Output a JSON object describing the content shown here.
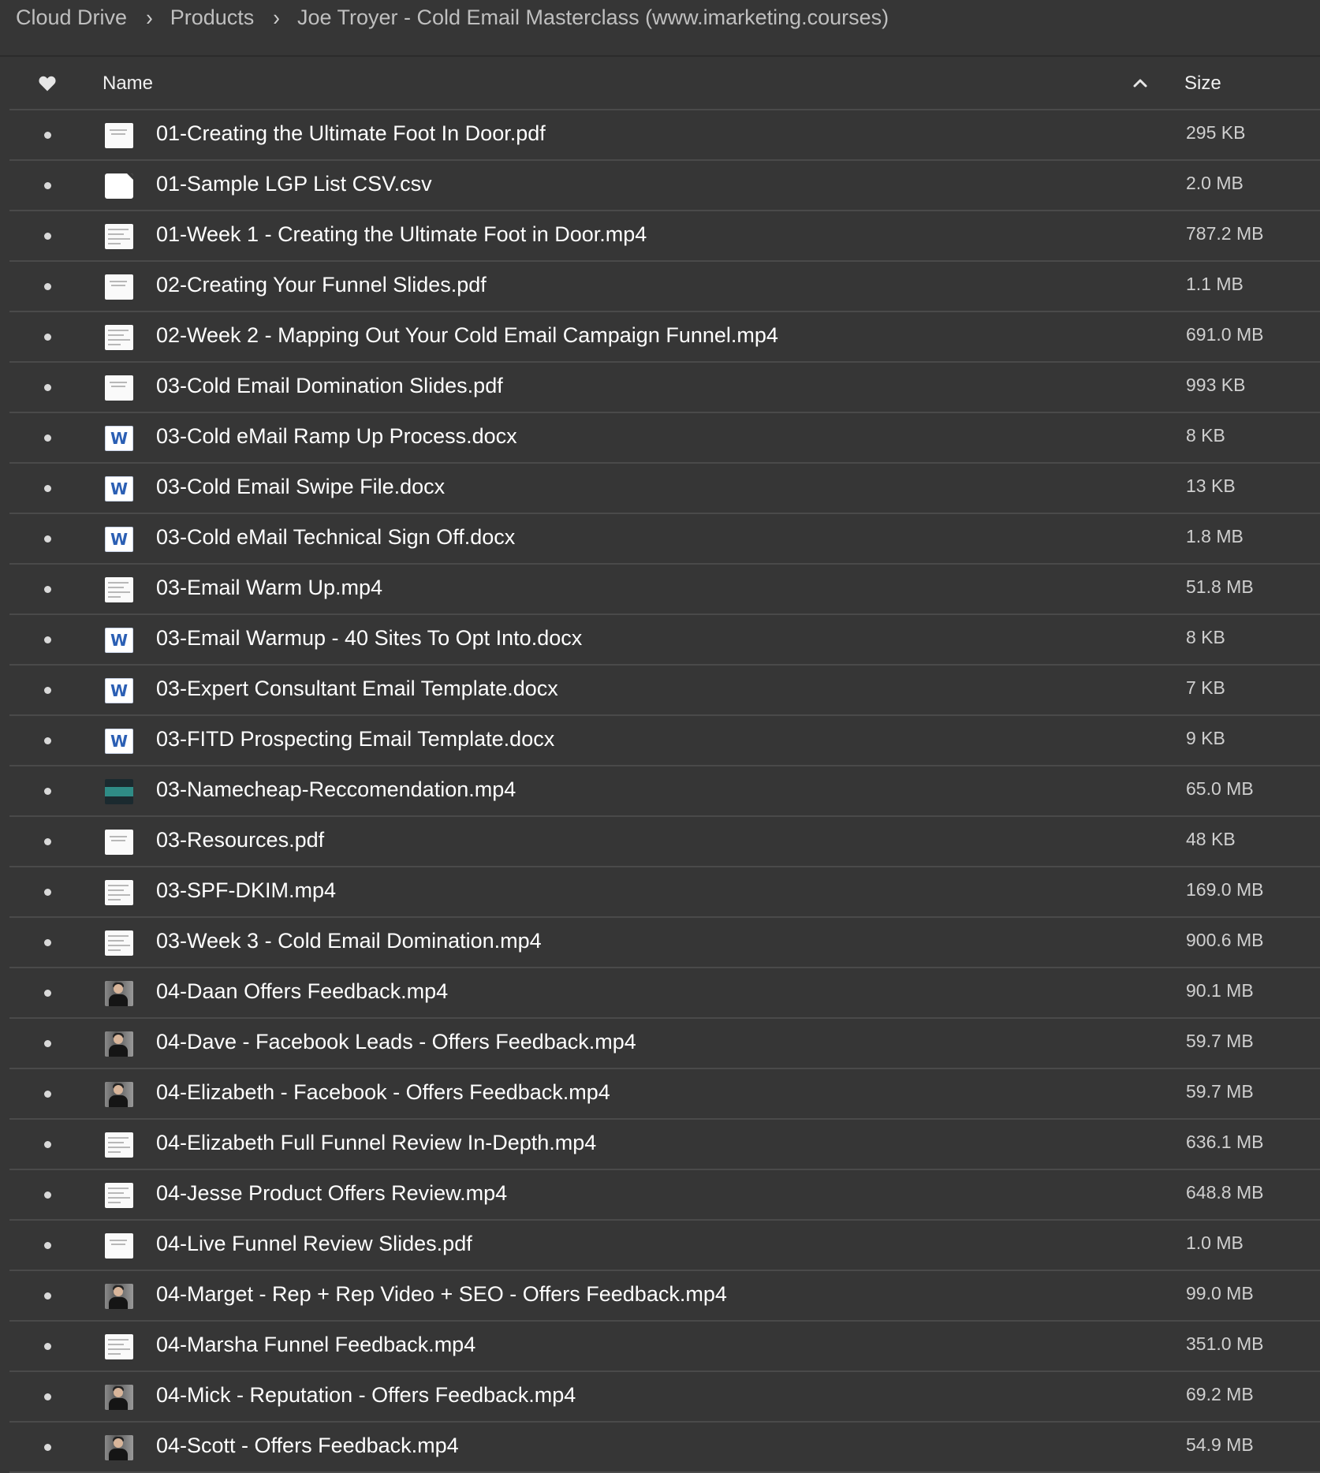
{
  "breadcrumb": [
    "Cloud Drive",
    "Products",
    "Joe Troyer - Cold Email Masterclass (www.imarketing.courses)"
  ],
  "header": {
    "name_label": "Name",
    "size_label": "Size",
    "sort_direction": "ascending"
  },
  "files": [
    {
      "name": "01-Creating the Ultimate Foot In Door.pdf",
      "size": "295 KB",
      "thumb": "slide"
    },
    {
      "name": "01-Sample LGP List CSV.csv",
      "size": "2.0 MB",
      "thumb": "doc"
    },
    {
      "name": "01-Week 1 - Creating the Ultimate Foot in Door.mp4",
      "size": "787.2 MB",
      "thumb": "vid"
    },
    {
      "name": "02-Creating Your Funnel Slides.pdf",
      "size": "1.1 MB",
      "thumb": "slide"
    },
    {
      "name": "02-Week 2 - Mapping Out Your Cold Email Campaign Funnel.mp4",
      "size": "691.0 MB",
      "thumb": "vid"
    },
    {
      "name": "03-Cold Email Domination Slides.pdf",
      "size": "993 KB",
      "thumb": "slide"
    },
    {
      "name": "03-Cold eMail Ramp Up Process.docx",
      "size": "8 KB",
      "thumb": "word"
    },
    {
      "name": "03-Cold Email Swipe File.docx",
      "size": "13 KB",
      "thumb": "word"
    },
    {
      "name": "03-Cold eMail Technical Sign Off.docx",
      "size": "1.8 MB",
      "thumb": "word"
    },
    {
      "name": "03-Email Warm Up.mp4",
      "size": "51.8 MB",
      "thumb": "vid"
    },
    {
      "name": "03-Email Warmup - 40 Sites To Opt Into.docx",
      "size": "8 KB",
      "thumb": "word"
    },
    {
      "name": "03-Expert Consultant Email Template.docx",
      "size": "7 KB",
      "thumb": "word"
    },
    {
      "name": "03-FITD Prospecting Email Template.docx",
      "size": "9 KB",
      "thumb": "word"
    },
    {
      "name": "03-Namecheap-Reccomendation.mp4",
      "size": "65.0 MB",
      "thumb": "teal"
    },
    {
      "name": "03-Resources.pdf",
      "size": "48 KB",
      "thumb": "slide"
    },
    {
      "name": "03-SPF-DKIM.mp4",
      "size": "169.0 MB",
      "thumb": "vid"
    },
    {
      "name": "03-Week 3 - Cold Email Domination.mp4",
      "size": "900.6 MB",
      "thumb": "vid"
    },
    {
      "name": "04-Daan Offers Feedback.mp4",
      "size": "90.1 MB",
      "thumb": "person"
    },
    {
      "name": "04-Dave - Facebook Leads - Offers Feedback.mp4",
      "size": "59.7 MB",
      "thumb": "person"
    },
    {
      "name": "04-Elizabeth - Facebook - Offers Feedback.mp4",
      "size": "59.7 MB",
      "thumb": "person"
    },
    {
      "name": "04-Elizabeth Full Funnel Review In-Depth.mp4",
      "size": "636.1 MB",
      "thumb": "vid"
    },
    {
      "name": "04-Jesse Product Offers Review.mp4",
      "size": "648.8 MB",
      "thumb": "vid"
    },
    {
      "name": "04-Live Funnel Review Slides.pdf",
      "size": "1.0 MB",
      "thumb": "slide"
    },
    {
      "name": "04-Marget - Rep + Rep Video + SEO - Offers Feedback.mp4",
      "size": "99.0 MB",
      "thumb": "person"
    },
    {
      "name": "04-Marsha Funnel Feedback.mp4",
      "size": "351.0 MB",
      "thumb": "vid"
    },
    {
      "name": "04-Mick - Reputation - Offers Feedback.mp4",
      "size": "69.2 MB",
      "thumb": "person"
    },
    {
      "name": "04-Scott - Offers Feedback.mp4",
      "size": "54.9 MB",
      "thumb": "person"
    }
  ],
  "icons": {
    "favorite_header": "heart-icon",
    "sort": "chevron-up-icon",
    "crumb_separator": "chevron-right-icon",
    "word_glyph": "W"
  }
}
